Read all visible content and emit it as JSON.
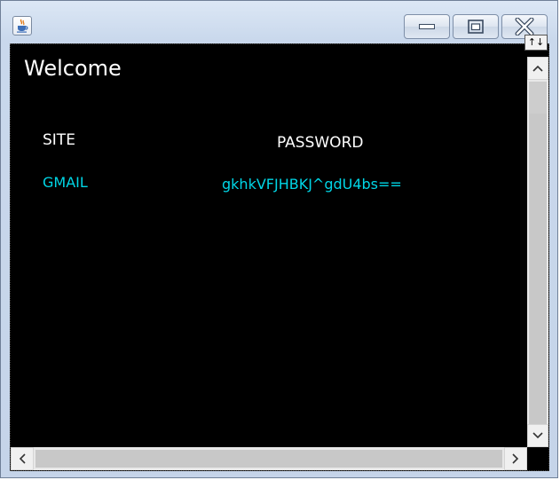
{
  "window": {
    "icon": "java-cup-icon",
    "controls": [
      "minimize-icon",
      "maximize-icon",
      "close-icon"
    ]
  },
  "resize_grip": {
    "label": "↑↓"
  },
  "main": {
    "welcome": "Welcome",
    "columns": {
      "site": "SITE",
      "password": "PASSWORD"
    },
    "rows": [
      {
        "site": "GMAIL",
        "password": "gkhkVFJHBKJ^gdU4bs=="
      }
    ],
    "text_color": "#ffffff",
    "value_color": "#00d6e6",
    "background": "#000000"
  },
  "scrollbars": {
    "vertical": [
      "chevron-up-icon",
      "chevron-down-icon"
    ],
    "horizontal": [
      "chevron-left-icon",
      "chevron-right-icon"
    ]
  }
}
